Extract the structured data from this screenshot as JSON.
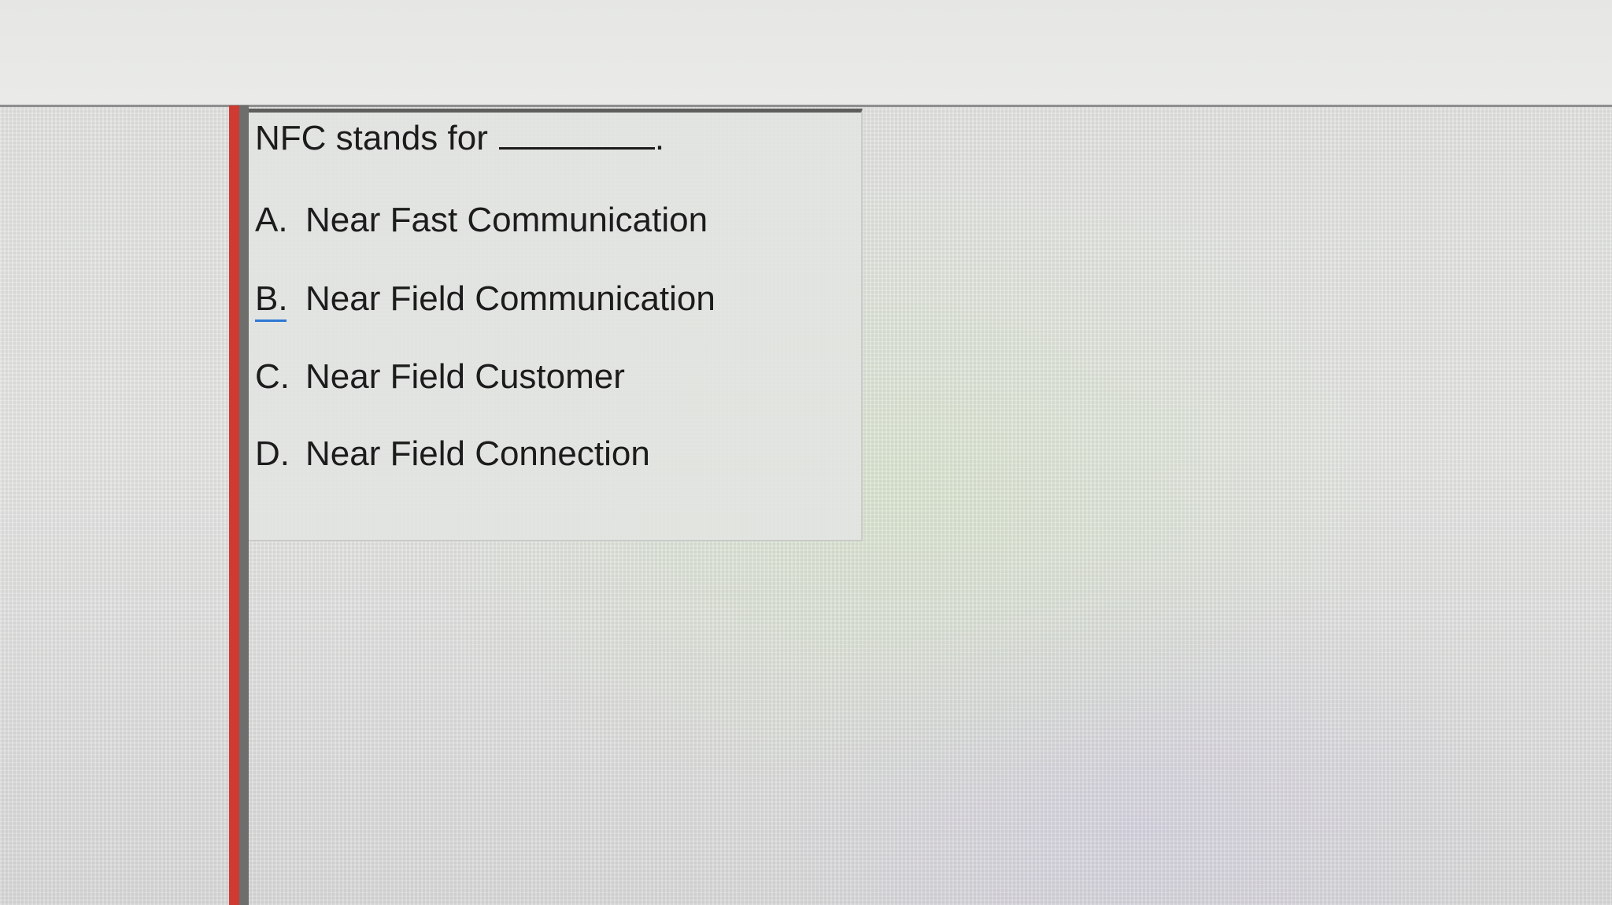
{
  "question": {
    "prompt": "NFC stands for",
    "blank_suffix": "."
  },
  "options": [
    {
      "letter": "A.",
      "text": "Near Fast Communication"
    },
    {
      "letter": "B.",
      "text": "Near Field Communication"
    },
    {
      "letter": "C.",
      "text": "Near Field Customer"
    },
    {
      "letter": "D.",
      "text": "Near Field Connection"
    }
  ],
  "colors": {
    "left_bar": "#cf3a33",
    "focus_underline": "#2d78d6",
    "text": "#1c1c1c"
  }
}
